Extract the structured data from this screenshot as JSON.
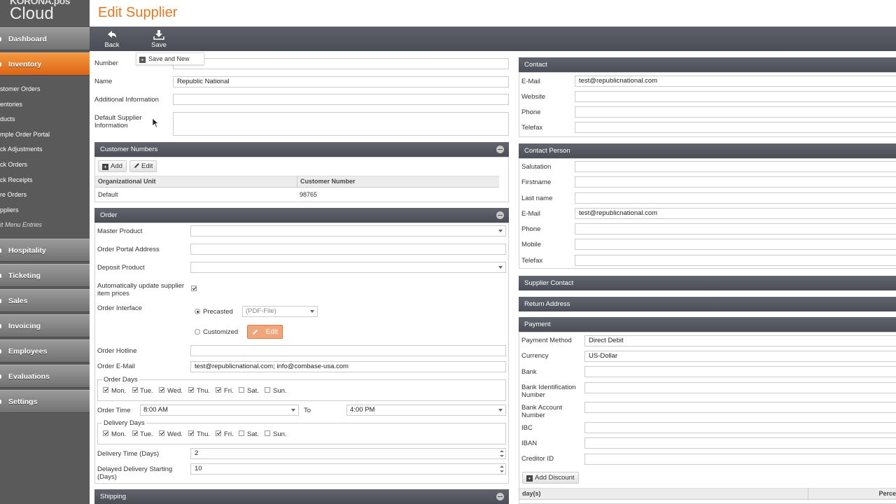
{
  "sidebar": {
    "logo_top": "KORONA.pos",
    "logo_bottom": "Cloud",
    "nav": {
      "dashboard": "Dashboard",
      "inventory": "Inventory",
      "hospitality": "Hospitality",
      "ticketing": "Ticketing",
      "sales": "Sales",
      "invoicing": "Invoicing",
      "employees": "Employees",
      "evaluations": "Evaluations",
      "settings": "Settings"
    },
    "sub": {
      "customer_orders": "stomer Orders",
      "inventories": "entories",
      "products": "ducts",
      "sample_portal": "mple Order Portal",
      "stock_adjustments": "ck Adjustments",
      "stock_orders": "ck Orders",
      "stock_receipts": "ck Receipts",
      "store_orders": "re Orders",
      "suppliers": "ppliers",
      "edit_menu": "it Menu Entries"
    }
  },
  "header": {
    "title": "Edit Supplier",
    "back": "Back",
    "save": "Save",
    "save_and_new": "Save and New"
  },
  "general": {
    "number_label": "Number",
    "number_value": "",
    "name_label": "Name",
    "name_value": "Republic National",
    "additional_label": "Additional Information",
    "default_label": "Default Supplier Information"
  },
  "customer_numbers": {
    "title": "Customer Numbers",
    "add": "Add",
    "edit": "Edit",
    "col_org": "Organizational Unit",
    "col_num": "Customer Number",
    "row_org": "Default",
    "row_num": "98765"
  },
  "order": {
    "title": "Order",
    "master_product": "Master Product",
    "portal_address": "Order Portal Address",
    "deposit_product": "Deposit Product",
    "auto_update": "Automatically update supplier item prices",
    "interface": "Order Interface",
    "precasted": "Precasted",
    "pdf_file": "(PDF-File)",
    "customized": "Customized",
    "edit": "Edit",
    "hotline": "Order Hotline",
    "email_label": "Order E-Mail",
    "email_value": "test@republicnational.com; info@combase-usa.com",
    "order_days": "Order Days",
    "delivery_days": "Delivery Days",
    "days": {
      "mon": "Mon.",
      "tue": "Tue.",
      "wed": "Wed.",
      "thu": "Thu.",
      "fri": "Fri.",
      "sat": "Sat.",
      "sun": "Sun."
    },
    "order_time": "Order Time",
    "time_from": "8:00 AM",
    "to": "To",
    "time_to": "4:00 PM",
    "delivery_time_label": "Delivery Time (Days)",
    "delivery_time_value": "2",
    "delayed_label": "Delayed Delivery Starting (Days)",
    "delayed_value": "10"
  },
  "shipping": {
    "title": "Shipping"
  },
  "contact": {
    "title": "Contact",
    "email_label": "E-Mail",
    "email_value": "test@republicnational.com",
    "website_label": "Website",
    "phone_label": "Phone",
    "telefax_label": "Telefax"
  },
  "contact_person": {
    "title": "Contact Person",
    "salutation": "Salutation",
    "firstname": "Firstname",
    "lastname": "Last name",
    "email_label": "E-Mail",
    "email_value": "test@republicnational.com",
    "phone": "Phone",
    "mobile": "Mobile",
    "telefax": "Telefax"
  },
  "supplier_contact": {
    "title": "Supplier Contact"
  },
  "return_address": {
    "title": "Return Address"
  },
  "payment": {
    "title": "Payment",
    "method_label": "Payment Method",
    "method_value": "Direct Debit",
    "currency_label": "Currency",
    "currency_value": "US-Dollar",
    "bank": "Bank",
    "bic": "Bank Identification Number",
    "account": "Bank Account Number",
    "ibc": "IBC",
    "iban": "IBAN",
    "creditor": "Creditor ID",
    "add_discount": "Add Discount",
    "col_days": "day(s)",
    "col_percent": "Perce"
  }
}
